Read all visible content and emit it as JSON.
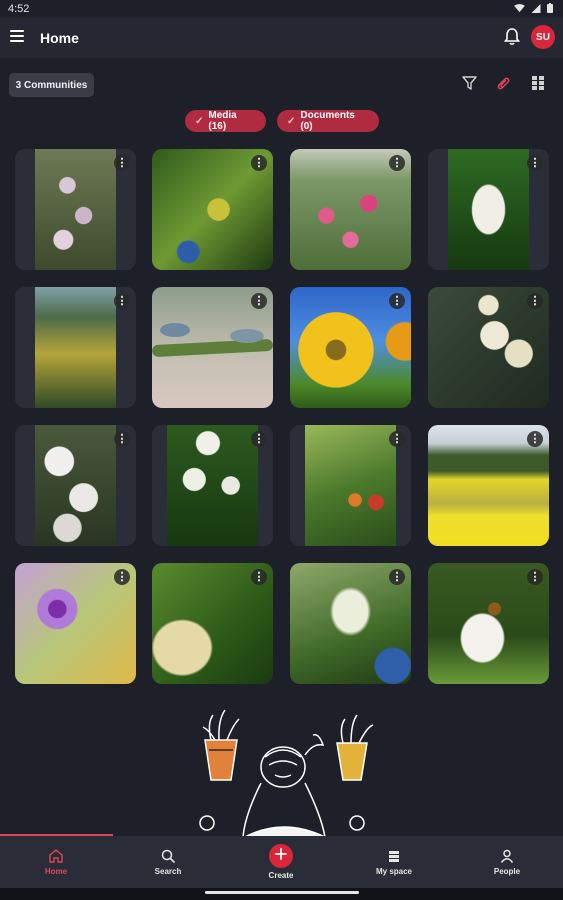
{
  "status": {
    "time": "4:52"
  },
  "header": {
    "title": "Home",
    "user_initials": "SU"
  },
  "toolbar": {
    "communities_label": "3 Communities"
  },
  "filters": [
    {
      "label": "Media (16)"
    },
    {
      "label": "Documents (0)"
    }
  ],
  "nav": [
    {
      "label": "Home",
      "icon": "home-icon",
      "active": true
    },
    {
      "label": "Search",
      "icon": "search-icon",
      "active": false
    },
    {
      "label": "Create",
      "icon": "plus-icon",
      "active": false
    },
    {
      "label": "My space",
      "icon": "stack-icon",
      "active": false
    },
    {
      "label": "People",
      "icon": "person-icon",
      "active": false
    }
  ],
  "colors": {
    "accent": "#d9263b",
    "chip": "#b02a40",
    "background": "#1d2029"
  },
  "media_icons": [
    "heather-flowers-photo",
    "green-leaves-bud-photo",
    "pink-meadow-flowers-photo",
    "white-blossom-cluster-photo",
    "conifer-forest-photo",
    "insects-on-stem-photo",
    "sunflower-photo",
    "eucalyptus-flowers-photo",
    "white-flowering-shrub-photo",
    "white-umbel-flowers-photo",
    "strawberry-tree-photo",
    "rapeseed-field-photo",
    "purple-thistle-flower-photo",
    "cream-flower-cluster-photo",
    "spiky-white-flowers-photo",
    "bee-on-white-flower-photo"
  ]
}
